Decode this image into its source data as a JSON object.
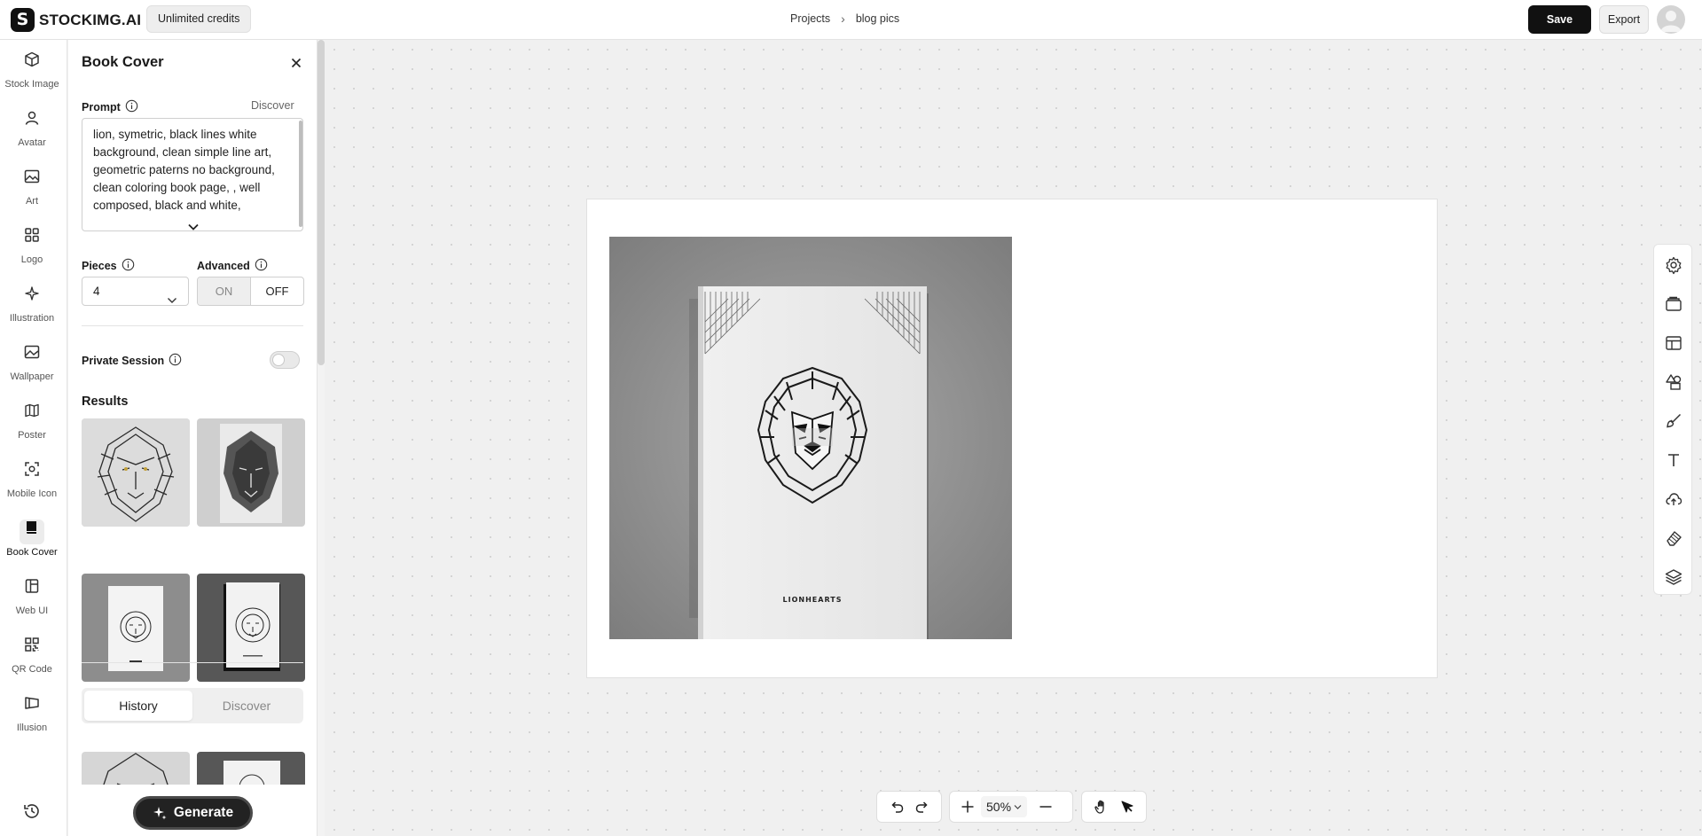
{
  "app": {
    "logo_text": "STOCKIMG.AI",
    "logo_mark": "S",
    "credits_badge": "Unlimited credits"
  },
  "breadcrumb": {
    "project": "Projects",
    "separator": "›",
    "current": "blog pics"
  },
  "header": {
    "save_label": "Save",
    "export_label": "Export"
  },
  "rail": {
    "items": [
      {
        "label": "Stock Image",
        "icon": "cube-icon"
      },
      {
        "label": "Avatar",
        "icon": "user-icon"
      },
      {
        "label": "Art",
        "icon": "image-icon"
      },
      {
        "label": "Logo",
        "icon": "grid-icon"
      },
      {
        "label": "Illustration",
        "icon": "sparkle-icon"
      },
      {
        "label": "Wallpaper",
        "icon": "wallpaper-icon"
      },
      {
        "label": "Poster",
        "icon": "map-icon"
      },
      {
        "label": "Mobile Icon",
        "icon": "app-icon"
      },
      {
        "label": "Book Cover",
        "icon": "book-icon",
        "active": true
      },
      {
        "label": "Web UI",
        "icon": "layout-icon"
      },
      {
        "label": "QR Code",
        "icon": "qr-icon"
      },
      {
        "label": "Illusion",
        "icon": "illusion-icon"
      }
    ],
    "history_icon": "history-icon"
  },
  "panel": {
    "title": "Book Cover",
    "prompt_label": "Prompt",
    "discover_link": "Discover",
    "prompt_text": "lion, symetric, black lines white background, clean simple line art, geometric paterns no background, clean coloring book page, , well composed, black and white,",
    "pieces_label": "Pieces",
    "pieces_value": "4",
    "advanced_label": "Advanced",
    "advanced_on": "ON",
    "advanced_off": "OFF",
    "advanced_selected": "OFF",
    "private_label": "Private Session",
    "private_enabled": false,
    "results_title": "Results",
    "tabs": [
      "History",
      "Discover"
    ],
    "active_tab": "History",
    "generate_label": "Generate"
  },
  "canvas": {
    "cover_text": "LIONHEARTS",
    "zoom": "50%"
  },
  "tools": [
    "settings-icon",
    "folder-icon",
    "layout-icon",
    "shapes-icon",
    "brush-icon",
    "text-icon",
    "upload-icon",
    "eraser-icon",
    "layers-icon"
  ],
  "colors": {
    "accent": "#111111",
    "canvas_bg": "#f0f0f0",
    "panel_bg": "#ffffff"
  }
}
